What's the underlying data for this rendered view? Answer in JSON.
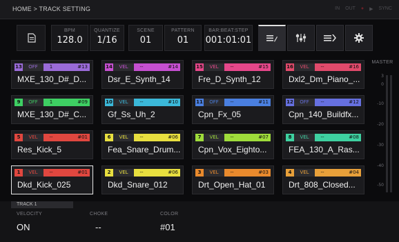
{
  "breadcrumb": "HOME > TRACK SETTING",
  "status": {
    "in": "IN",
    "out": "OUT",
    "play": "▶",
    "sync": "SYNC"
  },
  "header": {
    "bpm_label": "BPM",
    "bpm": "128.0",
    "quantize_label": "QUANTIZE",
    "quantize": "1/16",
    "scene_label": "SCENE",
    "scene": "01",
    "pattern_label": "PATTERN",
    "pattern": "01",
    "position_label": "BAR:BEAT:STEP",
    "position": "001:01:01"
  },
  "colors": {
    "purple": "#9a6bd8",
    "magenta": "#c54fd0",
    "pink": "#e5478a",
    "rose": "#e04a6b",
    "green": "#3ecf63",
    "cyan": "#3bb8d9",
    "blue": "#4a7fe0",
    "indigo": "#6670e0",
    "red": "#e0473f",
    "yellow": "#e8df3f",
    "lime": "#9fdc3b",
    "teal": "#3ed0a0",
    "orange": "#e98a2d",
    "amber": "#e8a03a"
  },
  "pads": [
    {
      "num": "13",
      "mode": "OFF",
      "ch": "1",
      "color_id": "#13",
      "name": "MXE_130_D#_D...",
      "color": "#9a6bd8"
    },
    {
      "num": "14",
      "mode": "VEL",
      "ch": "--",
      "color_id": "#14",
      "name": "Dsr_E_Synth_14",
      "color": "#c54fd0"
    },
    {
      "num": "15",
      "mode": "VEL",
      "ch": "--",
      "color_id": "#15",
      "name": "Fre_D_Synth_12",
      "color": "#e5478a"
    },
    {
      "num": "16",
      "mode": "VEL",
      "ch": "--",
      "color_id": "#16",
      "name": "Dxl2_Dm_Piano_...",
      "color": "#e04a6b"
    },
    {
      "num": "9",
      "mode": "OFF",
      "ch": "1",
      "color_id": "#09",
      "name": "MXE_130_D#_C...",
      "color": "#3ecf63"
    },
    {
      "num": "10",
      "mode": "VEL",
      "ch": "--",
      "color_id": "#10",
      "name": "Gf_Ss_Uh_2",
      "color": "#3bb8d9"
    },
    {
      "num": "11",
      "mode": "OFF",
      "ch": "--",
      "color_id": "#11",
      "name": "Cpn_Fx_05",
      "color": "#4a7fe0"
    },
    {
      "num": "12",
      "mode": "OFF",
      "ch": "--",
      "color_id": "#12",
      "name": "Cpn_140_Buildfx...",
      "color": "#6670e0"
    },
    {
      "num": "5",
      "mode": "VEL",
      "ch": "--",
      "color_id": "#01",
      "name": "Res_Kick_5",
      "color": "#e0473f"
    },
    {
      "num": "6",
      "mode": "VEL",
      "ch": "--",
      "color_id": "#06",
      "name": "Fea_Snare_Drum...",
      "color": "#e8df3f"
    },
    {
      "num": "7",
      "mode": "VEL",
      "ch": "--",
      "color_id": "#07",
      "name": "Cpn_Vox_Eighto...",
      "color": "#9fdc3b"
    },
    {
      "num": "8",
      "mode": "VEL",
      "ch": "--",
      "color_id": "#08",
      "name": "FEA_130_A_Ras...",
      "color": "#3ed0a0"
    },
    {
      "num": "1",
      "mode": "VEL",
      "ch": "--",
      "color_id": "#01",
      "name": "Dkd_Kick_025",
      "color": "#e0473f"
    },
    {
      "num": "2",
      "mode": "VEL",
      "ch": "--",
      "color_id": "#06",
      "name": "Dkd_Snare_012",
      "color": "#e8df3f"
    },
    {
      "num": "3",
      "mode": "VEL",
      "ch": "--",
      "color_id": "#03",
      "name": "Drt_Open_Hat_01",
      "color": "#e98a2d"
    },
    {
      "num": "4",
      "mode": "VEL",
      "ch": "--",
      "color_id": "#04",
      "name": "Drt_808_Closed...",
      "color": "#e8a03a"
    }
  ],
  "master": {
    "label": "MASTER",
    "scale": [
      "3",
      "0",
      "-10",
      "-20",
      "-30",
      "-40",
      "-50"
    ]
  },
  "track": {
    "tab": "TRACK 1",
    "velocity_label": "VELOCITY",
    "velocity": "ON",
    "choke_label": "CHOKE",
    "choke": "--",
    "color_label": "COLOR",
    "color": "#01"
  }
}
